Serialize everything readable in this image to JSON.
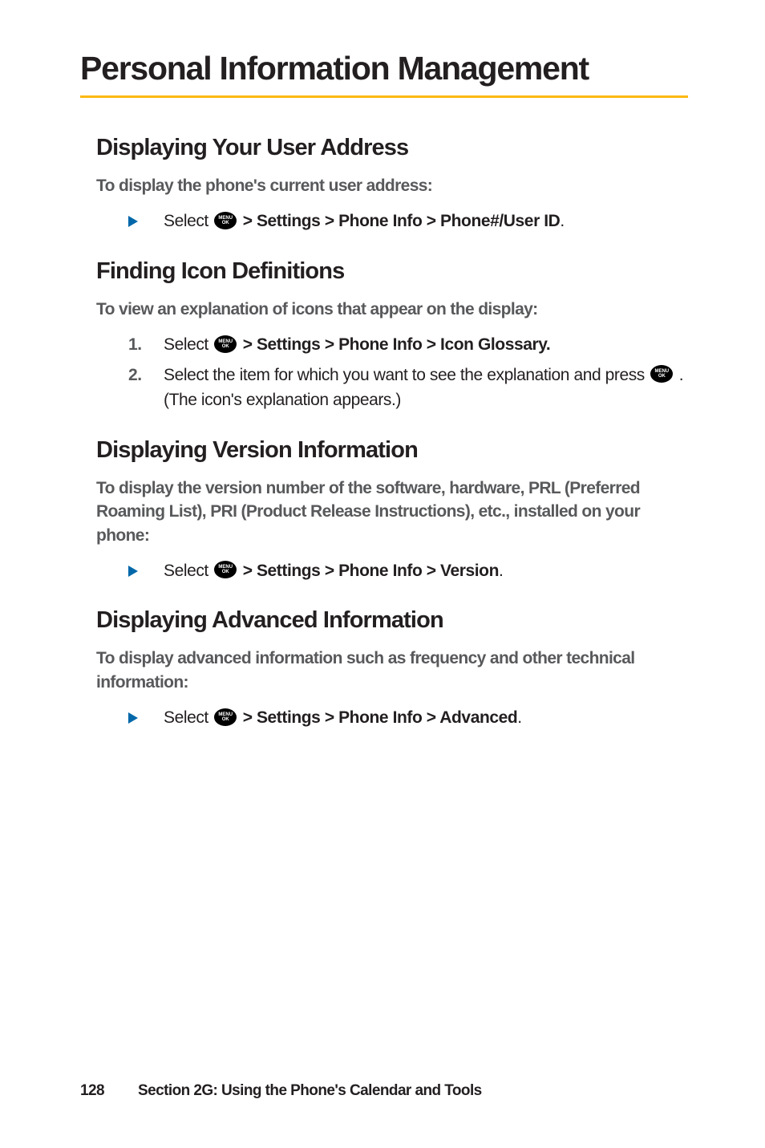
{
  "pageTitle": "Personal Information Management",
  "sections": {
    "userAddress": {
      "heading": "Displaying Your User Address",
      "intro": "To display the phone's current user address:",
      "step": {
        "prefix": "Select ",
        "path": " > Settings > Phone Info > Phone#/User ID",
        "suffix": "."
      }
    },
    "iconDefs": {
      "heading": "Finding Icon Definitions",
      "intro": "To view an explanation of icons that appear on the display:",
      "step1": {
        "num": "1.",
        "prefix": "Select ",
        "path": " > Settings > Phone Info > Icon Glossary."
      },
      "step2": {
        "num": "2.",
        "textA": "Select the item for which you want to see the explanation and press ",
        "textB": " . (The icon's explanation appears.)"
      }
    },
    "version": {
      "heading": "Displaying Version Information",
      "intro": "To display the version number of the software, hardware, PRL (Preferred Roaming List), PRI (Product Release Instructions), etc., installed on your phone:",
      "step": {
        "prefix": "Select ",
        "path": " > Settings > Phone Info > Version",
        "suffix": "."
      }
    },
    "advanced": {
      "heading": "Displaying Advanced Information",
      "intro": "To display advanced information such as frequency and other technical information:",
      "step": {
        "prefix": "Select ",
        "path": " > Settings > Phone Info > Advanced",
        "suffix": "."
      }
    }
  },
  "footer": {
    "page": "128",
    "section": "Section 2G: Using the Phone's Calendar and Tools"
  }
}
